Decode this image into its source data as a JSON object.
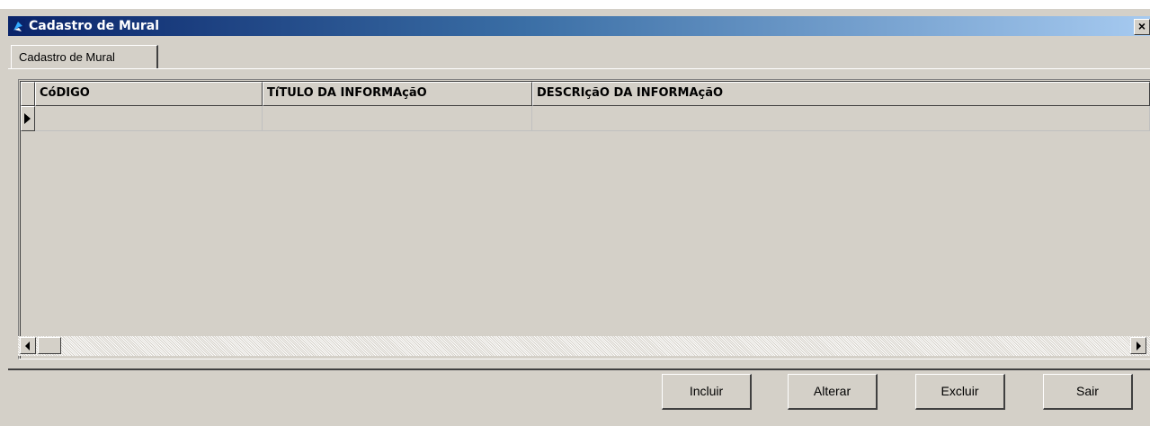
{
  "window": {
    "title": "Cadastro de Mural",
    "close_label": "×"
  },
  "tabs": [
    {
      "label": "Cadastro de Mural"
    }
  ],
  "grid": {
    "columns": [
      "CóDIGO",
      "TíTULO DA INFORMAçãO",
      "DESCRIçãO DA INFORMAçãO"
    ],
    "rows": [
      [
        "",
        "",
        ""
      ]
    ]
  },
  "buttons": {
    "incluir": "Incluir",
    "alterar": "Alterar",
    "excluir": "Excluir",
    "sair": "Sair"
  },
  "colors": {
    "titlebar_start": "#0a246a",
    "titlebar_end": "#a6caf0",
    "face": "#d4d0c8"
  }
}
